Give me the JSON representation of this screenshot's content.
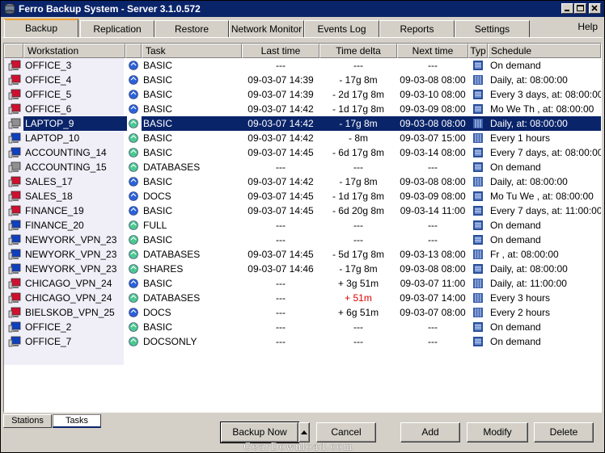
{
  "window": {
    "title": "Ferro Backup System - Server 3.1.0.572"
  },
  "tabs": [
    {
      "label": "Backup",
      "active": true
    },
    {
      "label": "Replication"
    },
    {
      "label": "Restore"
    },
    {
      "label": "Network Monitor"
    },
    {
      "label": "Events Log",
      "selected": true
    },
    {
      "label": "Reports"
    },
    {
      "label": "Settings"
    }
  ],
  "help_label": "Help",
  "columns": {
    "workstation": "Workstation",
    "task": "Task",
    "last_time": "Last time",
    "time_delta": "Time delta",
    "next_time": "Next time",
    "typ": "Typ",
    "schedule": "Schedule"
  },
  "rows": [
    {
      "ws": "OFFICE_3",
      "ws_color": "red",
      "task": "BASIC",
      "task_icon": "blue",
      "last": "---",
      "delta": "---",
      "next": "---",
      "typ": "full",
      "sched": "On demand"
    },
    {
      "ws": "OFFICE_4",
      "ws_color": "red",
      "task": "BASIC",
      "task_icon": "blue",
      "last": "09-03-07 14:39",
      "delta": "- 17g 8m",
      "next": "09-03-08 08:00",
      "typ": "incr",
      "sched": "Daily, at: 08:00:00"
    },
    {
      "ws": "OFFICE_5",
      "ws_color": "red",
      "task": "BASIC",
      "task_icon": "blue",
      "last": "09-03-07 14:39",
      "delta": "- 2d 17g 8m",
      "next": "09-03-10 08:00",
      "typ": "full",
      "sched": "Every 3 days, at: 08:00:00"
    },
    {
      "ws": "OFFICE_6",
      "ws_color": "red",
      "task": "BASIC",
      "task_icon": "blue",
      "last": "09-03-07 14:42",
      "delta": "- 1d 17g 8m",
      "next": "09-03-09 08:00",
      "typ": "full",
      "sched": "Mo We Th , at: 08:00:00"
    },
    {
      "ws": "LAPTOP_9",
      "ws_color": "gray",
      "task": "BASIC",
      "task_icon": "green",
      "last": "09-03-07 14:42",
      "delta": "- 17g 8m",
      "next": "09-03-08 08:00",
      "typ": "incr",
      "sched": "Daily, at: 08:00:00",
      "selected": true
    },
    {
      "ws": "LAPTOP_10",
      "ws_color": "blue",
      "task": "BASIC",
      "task_icon": "green",
      "last": "09-03-07 14:42",
      "delta": "- 8m",
      "next": "09-03-07 15:00",
      "typ": "incr",
      "sched": "Every 1 hours"
    },
    {
      "ws": "ACCOUNTING_14",
      "ws_color": "blue",
      "task": "BASIC",
      "task_icon": "green",
      "last": "09-03-07 14:45",
      "delta": "- 6d 17g 8m",
      "next": "09-03-14 08:00",
      "typ": "full",
      "sched": "Every 7 days, at: 08:00:00"
    },
    {
      "ws": "ACCOUNTING_15",
      "ws_color": "gray",
      "task": "DATABASES",
      "task_icon": "green",
      "last": "---",
      "delta": "---",
      "next": "---",
      "typ": "full",
      "sched": "On demand"
    },
    {
      "ws": "SALES_17",
      "ws_color": "red",
      "task": "BASIC",
      "task_icon": "blue",
      "last": "09-03-07 14:42",
      "delta": "- 17g 8m",
      "next": "09-03-08 08:00",
      "typ": "incr",
      "sched": "Daily, at: 08:00:00"
    },
    {
      "ws": "SALES_18",
      "ws_color": "red",
      "task": "DOCS",
      "task_icon": "blue",
      "last": "09-03-07 14:45",
      "delta": "- 1d 17g 8m",
      "next": "09-03-09 08:00",
      "typ": "full",
      "sched": "Mo Tu We , at: 08:00:00"
    },
    {
      "ws": "FINANCE_19",
      "ws_color": "red",
      "task": "BASIC",
      "task_icon": "blue",
      "last": "09-03-07 14:45",
      "delta": "- 6d 20g 8m",
      "next": "09-03-14 11:00",
      "typ": "full",
      "sched": "Every 7 days, at: 11:00:00"
    },
    {
      "ws": "FINANCE_20",
      "ws_color": "blue",
      "task": "FULL",
      "task_icon": "green",
      "last": "---",
      "delta": "---",
      "next": "---",
      "typ": "full",
      "sched": "On demand"
    },
    {
      "ws": "NEWYORK_VPN_23",
      "ws_color": "blue",
      "task": "BASIC",
      "task_icon": "green",
      "last": "---",
      "delta": "---",
      "next": "---",
      "typ": "full",
      "sched": "On demand"
    },
    {
      "ws": "NEWYORK_VPN_23",
      "ws_color": "blue",
      "task": "DATABASES",
      "task_icon": "green",
      "last": "09-03-07 14:45",
      "delta": "- 5d 17g 8m",
      "next": "09-03-13 08:00",
      "typ": "incr",
      "sched": "Fr , at: 08:00:00"
    },
    {
      "ws": "NEWYORK_VPN_23",
      "ws_color": "blue",
      "task": "SHARES",
      "task_icon": "green",
      "last": "09-03-07 14:46",
      "delta": "- 17g 8m",
      "next": "09-03-08 08:00",
      "typ": "full",
      "sched": "Daily, at: 08:00:00"
    },
    {
      "ws": "CHICAGO_VPN_24",
      "ws_color": "red",
      "task": "BASIC",
      "task_icon": "blue",
      "last": "---",
      "delta": "+ 3g 51m",
      "next": "09-03-07 11:00",
      "typ": "incr",
      "sched": "Daily, at: 11:00:00"
    },
    {
      "ws": "CHICAGO_VPN_24",
      "ws_color": "red",
      "task": "DATABASES",
      "task_icon": "green",
      "last": "---",
      "delta": "+ 51m",
      "delta_red": true,
      "next": "09-03-07 14:00",
      "typ": "incr",
      "sched": "Every 3 hours"
    },
    {
      "ws": "BIELSKOB_VPN_25",
      "ws_color": "red",
      "task": "DOCS",
      "task_icon": "blue",
      "last": "---",
      "delta": "+ 6g 51m",
      "next": "09-03-07 08:00",
      "typ": "incr",
      "sched": "Every 2 hours"
    },
    {
      "ws": "OFFICE_2",
      "ws_color": "blue",
      "task": "BASIC",
      "task_icon": "green",
      "last": "---",
      "delta": "---",
      "next": "---",
      "typ": "full",
      "sched": "On demand"
    },
    {
      "ws": "OFFICE_7",
      "ws_color": "blue",
      "task": "DOCSONLY",
      "task_icon": "green",
      "last": "---",
      "delta": "---",
      "next": "---",
      "typ": "full",
      "sched": "On demand"
    }
  ],
  "bottom_tabs": [
    {
      "label": "Stations"
    },
    {
      "label": "Tasks",
      "active": true
    }
  ],
  "buttons": {
    "backup_now": "Backup Now",
    "cancel": "Cancel",
    "add": "Add",
    "modify": "Modify",
    "delete": "Delete"
  },
  "watermark": "GearDownload.com",
  "colors": {
    "title_bar": "#0a246a",
    "selection": "#0a246a",
    "tab_accent": "#f0a030",
    "late_delta": "#e00000"
  }
}
